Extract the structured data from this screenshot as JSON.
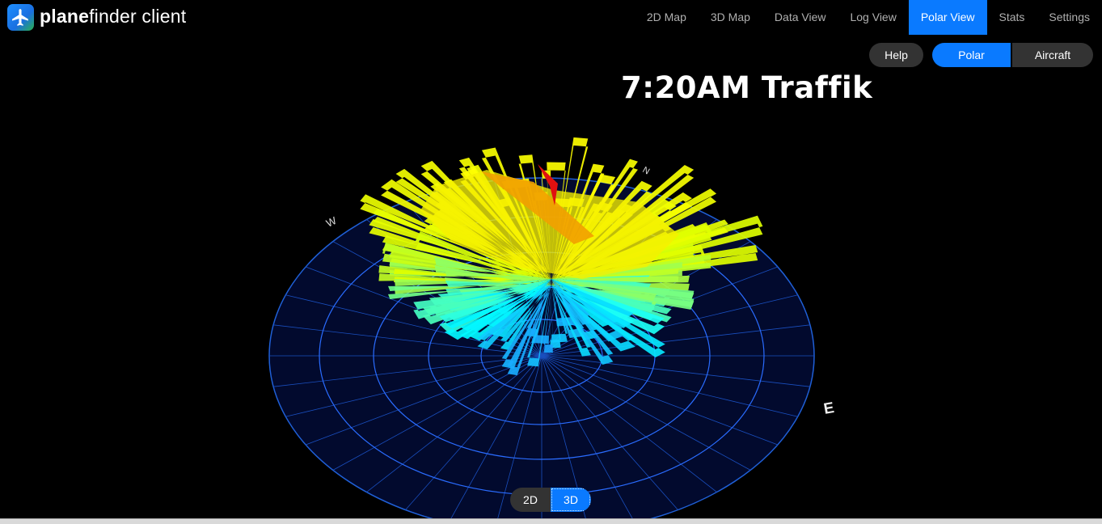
{
  "app": {
    "brand_bold": "plane",
    "brand_rest": "finder client"
  },
  "nav": [
    {
      "label": "2D Map",
      "active": false
    },
    {
      "label": "3D Map",
      "active": false
    },
    {
      "label": "Data View",
      "active": false
    },
    {
      "label": "Log View",
      "active": false
    },
    {
      "label": "Polar View",
      "active": true
    },
    {
      "label": "Stats",
      "active": false
    },
    {
      "label": "Settings",
      "active": false
    }
  ],
  "controls": {
    "help_label": "Help",
    "polar_label": "Polar",
    "aircraft_label": "Aircraft"
  },
  "view_title": "7:20AM Traffik",
  "compass": {
    "n": "N",
    "e": "E",
    "w": "W"
  },
  "view_toggle": {
    "label_2d": "2D",
    "label_3d": "3D",
    "selected": "3D"
  },
  "colors": {
    "accent": "#0a7aff",
    "grid": "#1f5fd6",
    "heading_marker": "#e01010"
  }
}
